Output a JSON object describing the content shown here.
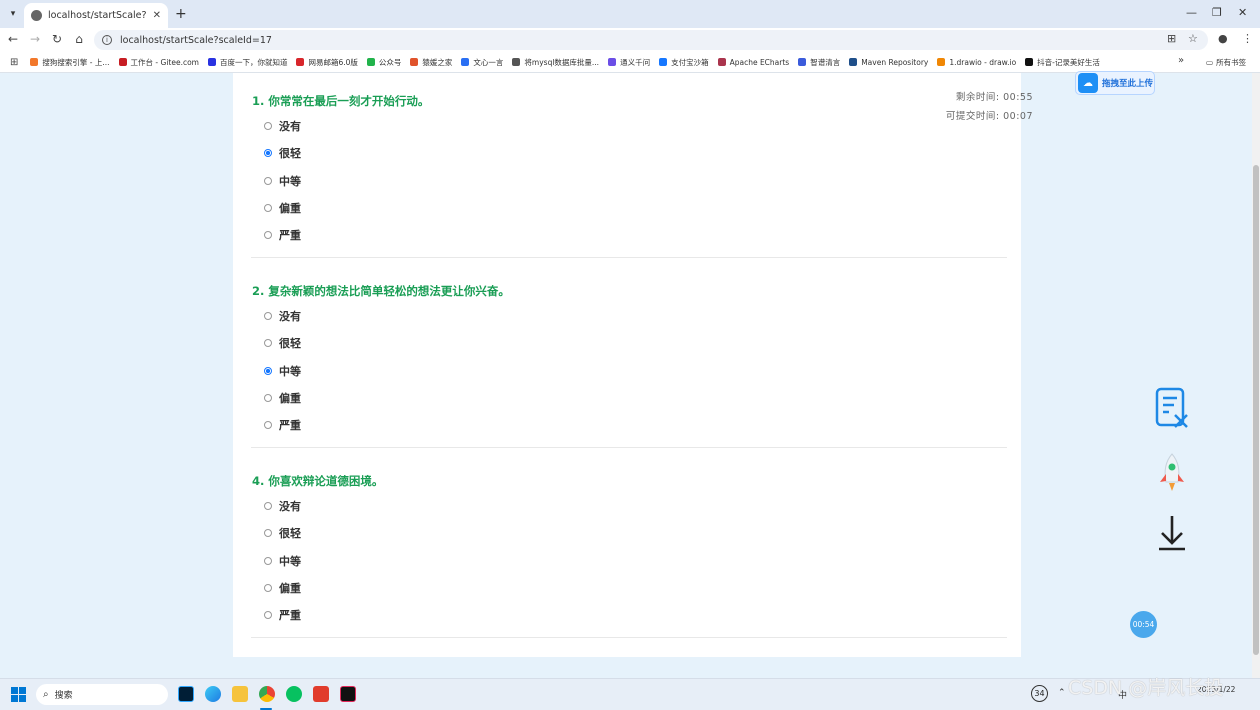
{
  "browser": {
    "tab_title": "localhost/startScale?scaleId=",
    "url": "localhost/startScale?scaleId=17",
    "bookmarks": [
      {
        "label": "搜狗搜索引擎 - 上...",
        "color": "#f2782b"
      },
      {
        "label": "工作台 - Gitee.com",
        "color": "#c71d23"
      },
      {
        "label": "百度一下，你就知道",
        "color": "#2932e1"
      },
      {
        "label": "网易邮箱6.0版",
        "color": "#d8262b"
      },
      {
        "label": "公众号",
        "color": "#21b34b"
      },
      {
        "label": "猿媛之家",
        "color": "#e0532b"
      },
      {
        "label": "文心一言",
        "color": "#2a6ff3"
      },
      {
        "label": "将mysql数据库批量...",
        "color": "#555555"
      },
      {
        "label": "通义千问",
        "color": "#6b4ee6"
      },
      {
        "label": "支付宝沙箱",
        "color": "#1677ff"
      },
      {
        "label": "Apache ECharts",
        "color": "#aa344d"
      },
      {
        "label": "智谱清言",
        "color": "#3b5bdb"
      },
      {
        "label": "Maven Repository",
        "color": "#1f4f8a"
      },
      {
        "label": "1.drawio - draw.io",
        "color": "#f08705"
      },
      {
        "label": "抖音-记录美好生活",
        "color": "#111111"
      }
    ],
    "all_bookmarks": "所有书签"
  },
  "quiz": {
    "remaining_label": "剩余时间:",
    "remaining_value": "00:55",
    "submit_label": "可提交时间:",
    "submit_value": "00:07",
    "questions": [
      {
        "title": "1. 你常常在最后一刻才开始行动。",
        "selected": 1
      },
      {
        "title": "2. 复杂新颖的想法比简单轻松的想法更让你兴奋。",
        "selected": 2
      },
      {
        "title": "4. 你喜欢辩论道德困境。",
        "selected": -1
      }
    ],
    "options": [
      "没有",
      "很轻",
      "中等",
      "偏重",
      "严重"
    ]
  },
  "floating": {
    "upload_label": "拖拽至此上传",
    "timer_bubble": "00:54"
  },
  "taskbar": {
    "search_placeholder": "搜索",
    "tray_badge": "34",
    "tray_lang": "中",
    "date": "2025/1/22"
  },
  "watermark": "CSDN @岸风长投",
  "colors": {
    "accent_green": "#1a9e55",
    "radio_blue": "#1677ff"
  }
}
